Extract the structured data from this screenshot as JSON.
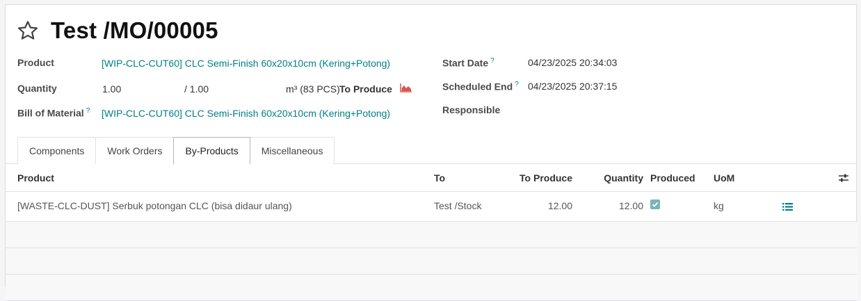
{
  "record": {
    "title": "Test /MO/00005"
  },
  "fields": {
    "product": {
      "label": "Product",
      "value": "[WIP-CLC-CUT60] CLC Semi-Finish 60x20x10cm (Kering+Potong)"
    },
    "quantity": {
      "label": "Quantity",
      "value": "1.00",
      "of": "/ 1.00",
      "uom": "m³ (83 PCS)",
      "to_produce": "To Produce"
    },
    "bom": {
      "label": "Bill of Material",
      "help": "?",
      "value": "[WIP-CLC-CUT60] CLC Semi-Finish 60x20x10cm (Kering+Potong)"
    },
    "start_date": {
      "label": "Start Date",
      "help": "?",
      "value": "04/23/2025 20:34:03"
    },
    "scheduled_end": {
      "label": "Scheduled End",
      "help": "?",
      "value": "04/23/2025 20:37:15"
    },
    "responsible": {
      "label": "Responsible"
    }
  },
  "tabs": [
    "Components",
    "Work Orders",
    "By-Products",
    "Miscellaneous"
  ],
  "active_tab": "By-Products",
  "table": {
    "columns": [
      "Product",
      "To",
      "To Produce",
      "Quantity",
      "Produced",
      "UoM"
    ],
    "rows": [
      {
        "product": "[WASTE-CLC-DUST] Serbuk potongan CLC (bisa didaur ulang)",
        "to": "Test /Stock",
        "to_produce": "12.00",
        "quantity": "12.00",
        "produced": true,
        "uom": "kg"
      }
    ]
  },
  "colors": {
    "accent": "#017e84",
    "chart_icon": "#d9534f",
    "checkbox": "#7ab4b8"
  },
  "icons": [
    "star-icon",
    "forecast-chart-icon",
    "column-settings-icon",
    "details-list-icon",
    "check-icon"
  ]
}
